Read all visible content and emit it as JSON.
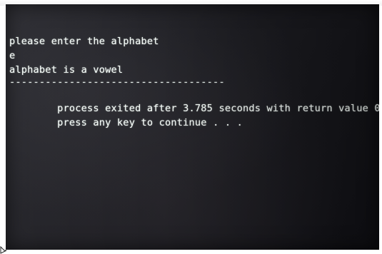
{
  "window": {
    "title_fragment": "——"
  },
  "console": {
    "lines": [
      "please enter the alphabet",
      "e",
      "alphabet is a vowel",
      "------------------------------------",
      "process exited after 3.785 seconds with return value 0",
      "press any key to continue . . ."
    ]
  },
  "colors": {
    "console_text": "#f3faf6",
    "screen_dark": "#1d1d22",
    "frame": "#ffffff"
  }
}
